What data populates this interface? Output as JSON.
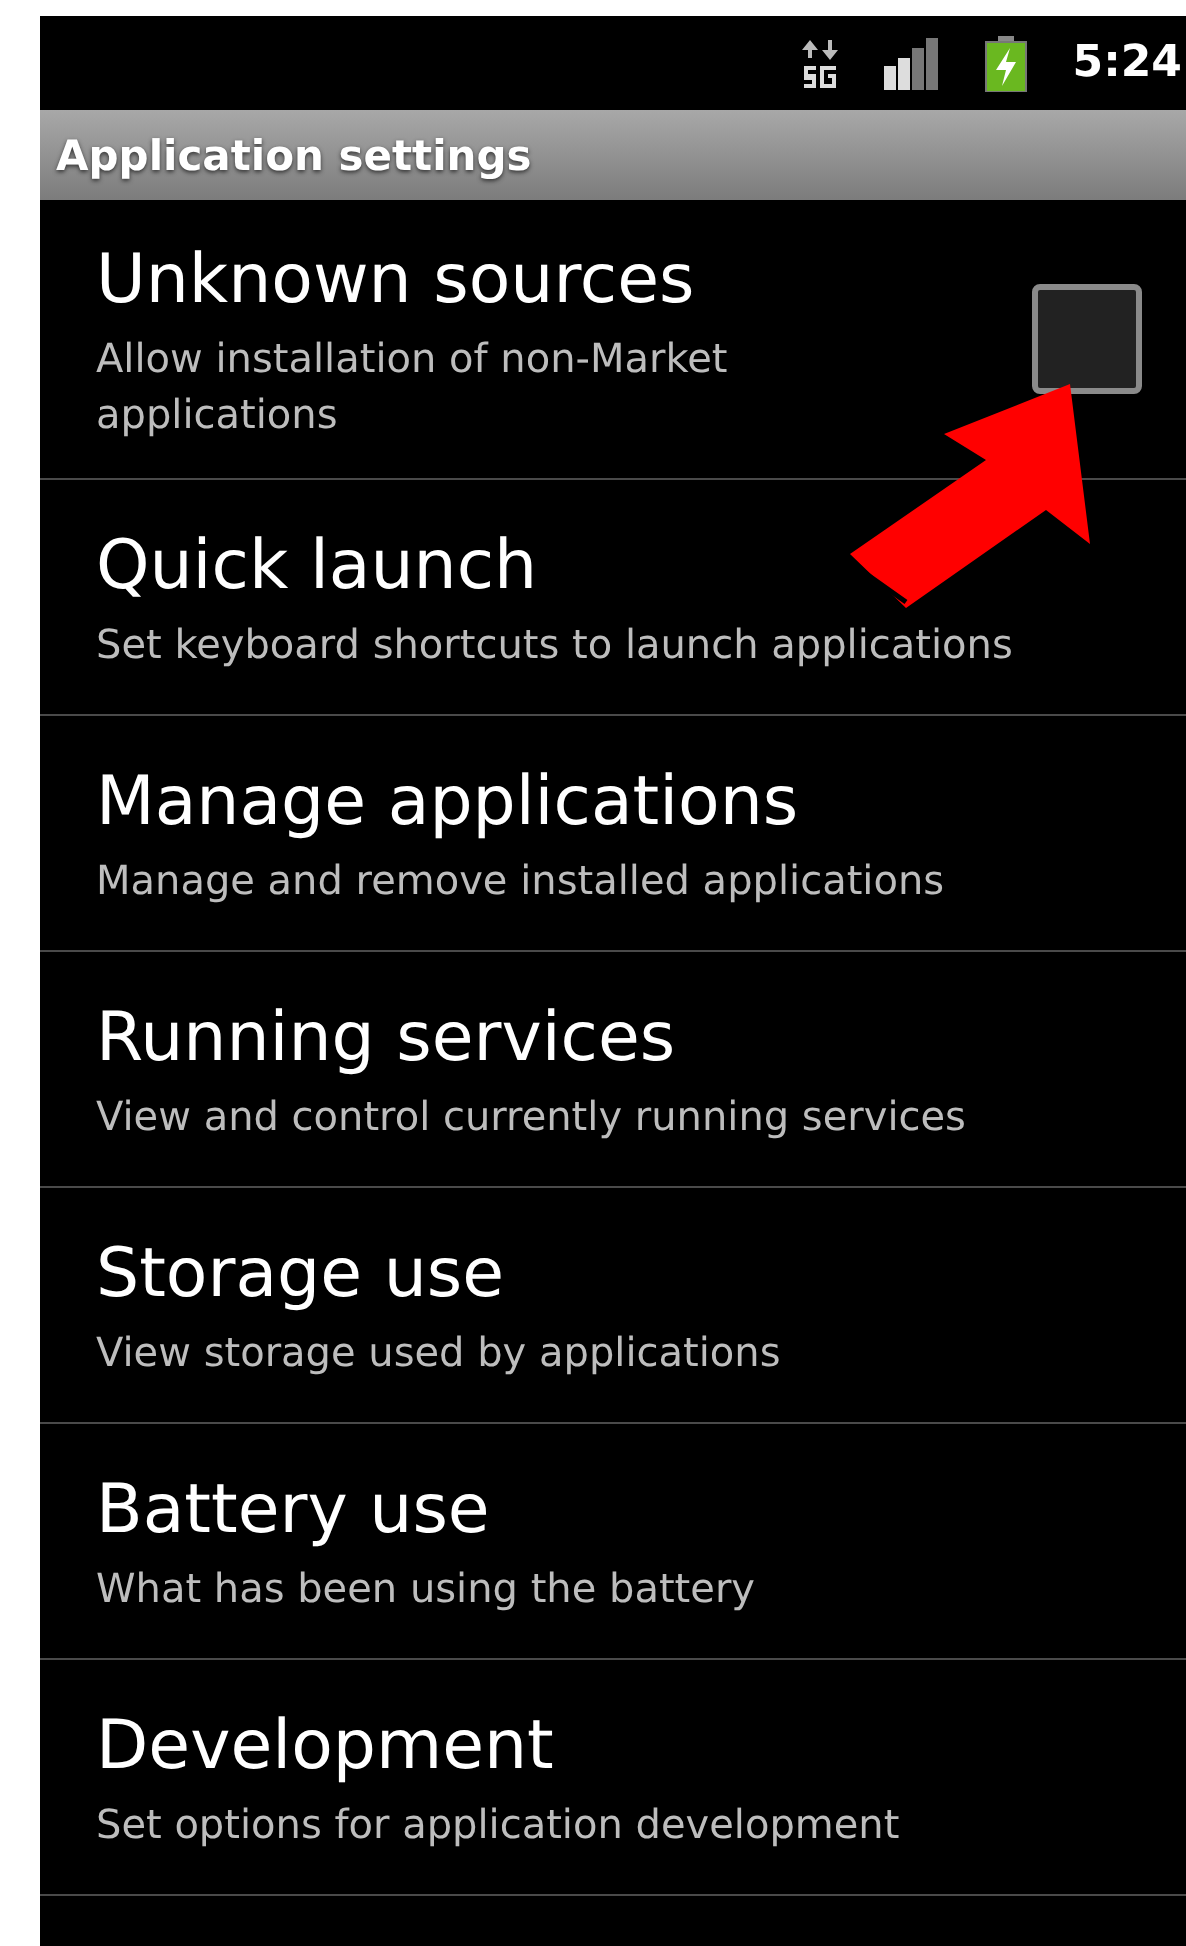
{
  "status_bar": {
    "time": "5:24"
  },
  "title_bar": {
    "title": "Application settings"
  },
  "settings": [
    {
      "kind": "checkbox",
      "title": "Unknown sources",
      "summary": "Allow installation of non-Market applications",
      "checked": false
    },
    {
      "kind": "plain",
      "title": "Quick launch",
      "summary": "Set keyboard shortcuts to launch applications"
    },
    {
      "kind": "plain",
      "title": "Manage applications",
      "summary": "Manage and remove installed applications"
    },
    {
      "kind": "plain",
      "title": "Running services",
      "summary": "View and control currently running services"
    },
    {
      "kind": "plain",
      "title": "Storage use",
      "summary": "View storage used by applications"
    },
    {
      "kind": "plain",
      "title": "Battery use",
      "summary": "What has been using the battery"
    },
    {
      "kind": "plain",
      "title": "Development",
      "summary": "Set options for application development"
    }
  ]
}
